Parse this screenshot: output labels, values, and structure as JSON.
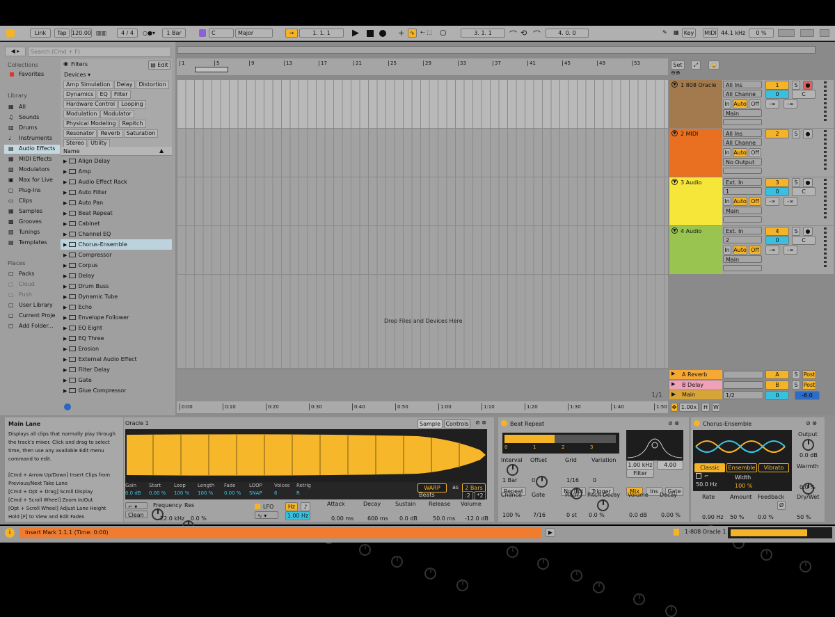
{
  "topbar": {
    "link": "Link",
    "tap": "Tap",
    "tempo": "120.00",
    "meter": "4 / 4",
    "quant": "1 Bar",
    "key": "C",
    "scale": "Major",
    "pos": "1.   1.   1",
    "loop_start": "3.   1.   1",
    "loop_len": "4.   0.   0",
    "key_label": "Key",
    "midi_label": "MIDI",
    "samplerate": "44.1 kHz",
    "cpu": "0 %"
  },
  "search": {
    "placeholder": "Search (Cmd + F)"
  },
  "places": {
    "collections_h": "Collections",
    "favorites": "Favorites",
    "library_h": "Library",
    "items": [
      "All",
      "Sounds",
      "Drums",
      "Instruments",
      "Audio Effects",
      "MIDI Effects",
      "Modulators",
      "Max for Live",
      "Plug-Ins",
      "Clips",
      "Samples",
      "Grooves",
      "Tunings",
      "Templates"
    ],
    "places_h": "Places",
    "places": [
      "Packs",
      "Cloud",
      "Push",
      "User Library",
      "Current Proje",
      "Add Folder..."
    ]
  },
  "filters": {
    "title": "Filters",
    "edit": "Edit",
    "devices": "Devices ▾",
    "tags": [
      "Amp Simulation",
      "Delay",
      "Distortion",
      "Dynamics",
      "EQ",
      "Filter",
      "Hardware Control",
      "Looping",
      "Modulation",
      "Modulator",
      "Physical Modeling",
      "Repitch",
      "Resonator",
      "Reverb",
      "Saturation",
      "Stereo",
      "Utility"
    ]
  },
  "list": {
    "header": "Name",
    "items": [
      "Align Delay",
      "Amp",
      "Audio Effect Rack",
      "Auto Filter",
      "Auto Pan",
      "Beat Repeat",
      "Cabinet",
      "Channel EQ",
      "Chorus-Ensemble",
      "Compressor",
      "Corpus",
      "Delay",
      "Drum Buss",
      "Dynamic Tube",
      "Echo",
      "Envelope Follower",
      "EQ Eight",
      "EQ Three",
      "Erosion",
      "External Audio Effect",
      "Filter Delay",
      "Gate",
      "Glue Compressor"
    ],
    "selected": 8
  },
  "ruler": {
    "bars": [
      "1",
      "5",
      "9",
      "13",
      "17",
      "21",
      "25",
      "29",
      "33",
      "37",
      "41",
      "45",
      "49",
      "53"
    ],
    "times": [
      "0:00",
      "0:10",
      "0:20",
      "0:30",
      "0:40",
      "0:50",
      "1:00",
      "1:10",
      "1:20",
      "1:30",
      "1:40",
      "1:50"
    ],
    "page": "1/1"
  },
  "arrangement": {
    "drop_text": "Drop Files and Devices Here",
    "set": "Set"
  },
  "tracks": [
    {
      "name": "1 808 Oracle",
      "color": "#a37a4e",
      "in": "All Ins",
      "ch": "All Channe",
      "out": "Main",
      "num": "1",
      "vol": "0",
      "pan": "C",
      "send1": "-∞",
      "send2": "-∞"
    },
    {
      "name": "2 MIDI",
      "color": "#e87020",
      "in": "All Ins",
      "ch": "All Channe",
      "out": "No Output",
      "num": "2",
      "vol": "",
      "pan": "",
      "send1": "",
      "send2": ""
    },
    {
      "name": "3 Audio",
      "color": "#f5e639",
      "in": "Ext. In",
      "ch": "1",
      "out": "Main",
      "num": "3",
      "vol": "0",
      "pan": "C",
      "send1": "-∞",
      "send2": "-∞"
    },
    {
      "name": "4 Audio",
      "color": "#98c44f",
      "in": "Ext. In",
      "ch": "2",
      "out": "Main",
      "num": "4",
      "vol": "0",
      "pan": "C",
      "send1": "-∞",
      "send2": "-∞"
    }
  ],
  "returns": [
    {
      "name": "A Reverb",
      "color": "#f5a833",
      "num": "A",
      "post": "Post"
    },
    {
      "name": "B Delay",
      "color": "#f0a0b8",
      "num": "B",
      "post": "Post"
    }
  ],
  "main": {
    "name": "Main",
    "ratio": "1/2",
    "vol": "0",
    "pan": "-6.0",
    "zoom": "1.00x"
  },
  "info": {
    "title": "Main Lane",
    "body": "Displays all clips that normally play through the track's mixer. Click and drag to select time, then use any available Edit menu command to edit.",
    "shortcuts": [
      "[Cmd + Arrow Up/Down] Insert Clips from Previous/Next Take Lane",
      "[Cmd + Opt + Drag] Scroll Display",
      "[Cmd + Scroll Wheel] Zoom In/Out",
      "[Opt + Scroll Wheel] Adjust Lane Height",
      "Hold [F] to View and Edit Fades"
    ]
  },
  "sampler": {
    "name": "Oracle 1",
    "tab1": "Sample",
    "tab2": "Controls",
    "params": [
      "Gain",
      "Start",
      "Loop",
      "Length",
      "Fade",
      "LOOP",
      "Voices",
      "Retrig"
    ],
    "values": [
      "0.0 dB",
      "0.00 %",
      "100 %",
      "100 %",
      "0.00 %",
      "SNAP",
      "6",
      "R"
    ],
    "warp": "WARP",
    "as": "as",
    "bars": "2 Bars",
    "beats": "Beats",
    "div": ":2",
    "mul": "*2",
    "freq": "Frequency",
    "res": "Res",
    "freq_val": "22.0 kHz",
    "res_val": "0.0 %",
    "filter": "Clean",
    "lfo": "LFO",
    "hz": "Hz",
    "lfo_val": "1.00 Hz",
    "attack": "Attack",
    "decay": "Decay",
    "sustain": "Sustain",
    "release": "Release",
    "volume": "Volume",
    "attack_v": "0.00 ms",
    "decay_v": "600 ms",
    "sustain_v": "0.0 dB",
    "release_v": "50.0 ms",
    "volume_v": "-12.0 dB"
  },
  "beatrepeat": {
    "name": "Beat Repeat",
    "labels": [
      "Interval",
      "Offset",
      "Grid",
      "Variation",
      "Chance",
      "Gate",
      "Pitch",
      "Pitch Decay",
      "Volume",
      "Decay"
    ],
    "values": [
      "1 Bar",
      "0",
      "1/16",
      "0",
      "100 %",
      "7/16",
      "0 st",
      "0.0 %",
      "0.0 dB",
      "0.00 %"
    ],
    "filterf": "1.00 kHz",
    "filterw": "4.00",
    "filter": "Filter",
    "repeat": "Repeat",
    "notrpl": "No Trpl",
    "trigger": "Trigger",
    "mix": "Mix",
    "ins": "Ins",
    "gate": "Gate",
    "ticks": [
      "0",
      "1",
      "2",
      "3"
    ]
  },
  "chorus": {
    "name": "Chorus-Ensemble",
    "output": "Output",
    "output_v": "0.0 dB",
    "warmth": "Warmth",
    "warmth_v": "0.0 %",
    "modes": [
      "Classic",
      "Ensemble",
      "Vibrato"
    ],
    "width": "Width",
    "width_v": "100 %",
    "hz": "50.0 Hz",
    "rate": "Rate",
    "rate_v": "0.90 Hz",
    "amount": "Amount",
    "amount_v": "50 %",
    "feedback": "Feedback",
    "feedback_v": "0.0 %",
    "drywet": "Dry/Wet",
    "drywet_v": "50 %",
    "phi": "Ø"
  },
  "status": {
    "message": "Insert Mark 1.1.1 (Time: 0:00)",
    "track": "1-808 Oracle 1"
  }
}
